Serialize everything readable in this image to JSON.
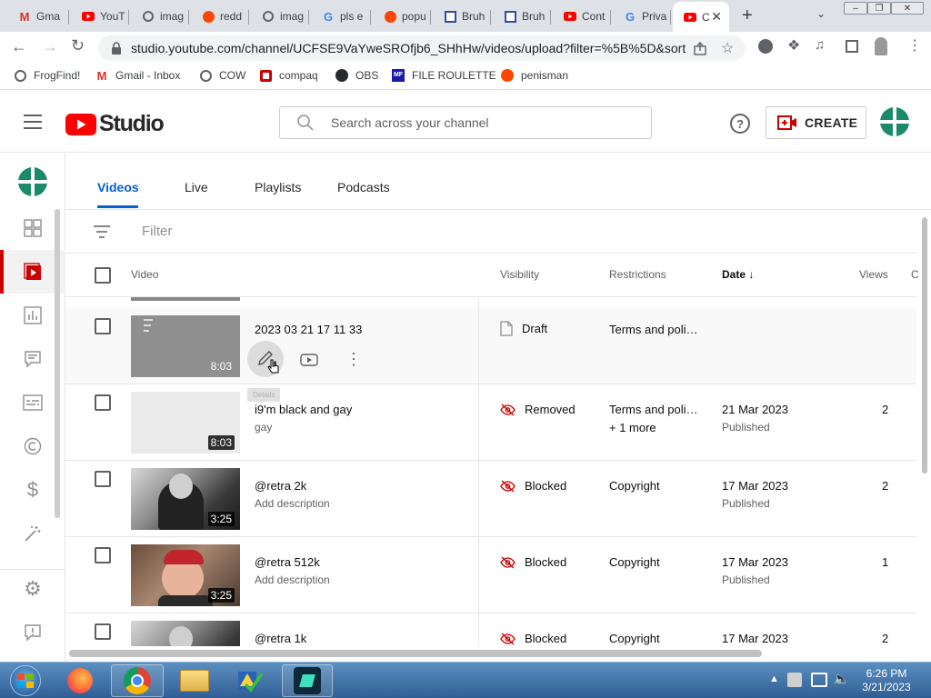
{
  "browser": {
    "tabs": [
      {
        "label": "Gma",
        "icon": "gmail-icon"
      },
      {
        "label": "YouT",
        "icon": "youtube-icon"
      },
      {
        "label": "imag",
        "icon": "globe-icon"
      },
      {
        "label": "redd",
        "icon": "reddit-icon"
      },
      {
        "label": "imag",
        "icon": "globe-icon"
      },
      {
        "label": "pls e",
        "icon": "google-icon"
      },
      {
        "label": "popu",
        "icon": "reddit-icon"
      },
      {
        "label": "Bruh",
        "icon": "bookmark-app-icon"
      },
      {
        "label": "Bruh",
        "icon": "bookmark-app-icon"
      },
      {
        "label": "Cont",
        "icon": "youtube-icon"
      },
      {
        "label": "Priva",
        "icon": "google-icon"
      },
      {
        "label": "C",
        "icon": "youtube-studio-icon",
        "active": true
      }
    ],
    "url": "studio.youtube.com/channel/UCFSE9VaYweSROfjb6_SHhHw/videos/upload?filter=%5B%5D&sort...",
    "bookmarks": [
      {
        "label": "FrogFind!",
        "icon": "globe-icon"
      },
      {
        "label": "Gmail - Inbox",
        "icon": "gmail-icon"
      },
      {
        "label": "COW",
        "icon": "globe-icon"
      },
      {
        "label": "compaq",
        "icon": "compaq-icon"
      },
      {
        "label": "OBS",
        "icon": "github-icon"
      },
      {
        "label": "FILE ROULETTE",
        "icon": "mf-icon"
      },
      {
        "label": "penisman",
        "icon": "reddit-icon"
      }
    ]
  },
  "studio": {
    "logo_text": "Studio",
    "search_placeholder": "Search across your channel",
    "create_label": "CREATE",
    "content_tabs": [
      "Videos",
      "Live",
      "Playlists",
      "Podcasts"
    ],
    "active_tab": "Videos",
    "filter_placeholder": "Filter",
    "columns": {
      "video": "Video",
      "visibility": "Visibility",
      "restrictions": "Restrictions",
      "date": "Date",
      "views": "Views",
      "comments": "C"
    },
    "tooltip": "Details",
    "rows": [
      {
        "title": "2023 03 21 17 11 33",
        "description": "",
        "duration": "8:03",
        "visibility": "Draft",
        "restrictions": "Terms and poli…",
        "restrictions_more": "",
        "date": "",
        "status": "",
        "views": "",
        "thumb": "grey"
      },
      {
        "title": "i9'm black and gay",
        "description": "gay",
        "duration": "8:03",
        "visibility": "Removed",
        "restrictions": "Terms and poli…",
        "restrictions_more": "+ 1 more",
        "date": "21 Mar 2023",
        "status": "Published",
        "views": "2",
        "thumb": "light"
      },
      {
        "title": "@retra 2k",
        "description": "Add description",
        "duration": "3:25",
        "visibility": "Blocked",
        "restrictions": "Copyright",
        "restrictions_more": "",
        "date": "17 Mar 2023",
        "status": "Published",
        "views": "2",
        "thumb": "bw"
      },
      {
        "title": "@retra 512k",
        "description": "Add description",
        "duration": "3:25",
        "visibility": "Blocked",
        "restrictions": "Copyright",
        "restrictions_more": "",
        "date": "17 Mar 2023",
        "status": "Published",
        "views": "1",
        "thumb": "color"
      },
      {
        "title": "@retra 1k",
        "description": "",
        "duration": "",
        "visibility": "Blocked",
        "restrictions": "Copyright",
        "restrictions_more": "",
        "date": "17 Mar 2023",
        "status": "",
        "views": "2",
        "thumb": "bw"
      }
    ]
  },
  "taskbar": {
    "time": "6:26 PM",
    "date": "3/21/2023"
  },
  "colors": {
    "youtube_red": "#ff0000",
    "accent_blue": "#065fd4",
    "blocked_red": "#cc0000"
  }
}
